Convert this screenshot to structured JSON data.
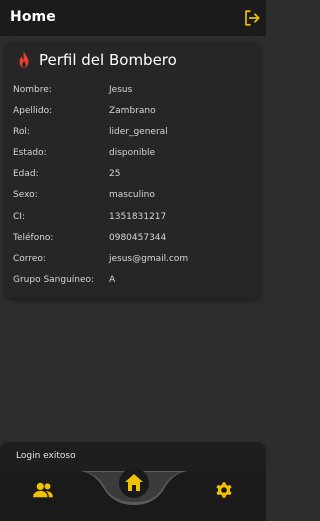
{
  "appbar": {
    "title": "Home",
    "logout_icon": "logout-icon"
  },
  "profile": {
    "title": "Perfil del Bombero",
    "icon": "fire-icon",
    "fields": [
      {
        "label": "Nombre:",
        "value": "Jesus"
      },
      {
        "label": "Apellido:",
        "value": "Zambrano"
      },
      {
        "label": "Rol:",
        "value": "lider_general"
      },
      {
        "label": "Estado:",
        "value": "disponible"
      },
      {
        "label": "Edad:",
        "value": "25"
      },
      {
        "label": "Sexo:",
        "value": "masculino"
      },
      {
        "label": "CI:",
        "value": "1351831217"
      },
      {
        "label": "Teléfono:",
        "value": "0980457344"
      },
      {
        "label": "Correo:",
        "value": "jesus@gmail.com"
      },
      {
        "label": "Grupo Sanguíneo:",
        "value": "A"
      }
    ]
  },
  "toast": {
    "message": "Login exitoso"
  },
  "bottom_nav": {
    "items": [
      {
        "icon": "users-icon"
      },
      {
        "icon": "home-icon",
        "selected": true
      },
      {
        "icon": "gear-icon"
      }
    ],
    "accent_color": "#f2c200"
  },
  "colors": {
    "background": "#2d2d2d",
    "surface": "#262626",
    "accent": "#f2c200",
    "fire": "#e8402a"
  }
}
